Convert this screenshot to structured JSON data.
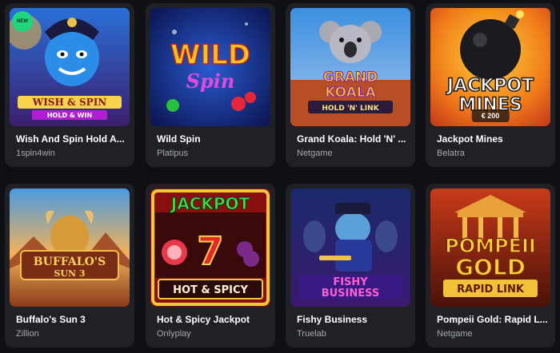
{
  "games": [
    {
      "title": "Wish And Spin Hold A...",
      "provider": "1spin4win",
      "badge": "NEW",
      "art_lines": [
        "WISH & SPIN",
        "HOLD & WIN"
      ]
    },
    {
      "title": "Wild Spin",
      "provider": "Platipus",
      "art_lines": [
        "WILD",
        "Spin"
      ]
    },
    {
      "title": "Grand Koala: Hold 'N' ...",
      "provider": "Netgame",
      "art_lines": [
        "GRAND",
        "KOALA",
        "HOLD 'N' LINK"
      ]
    },
    {
      "title": "Jackpot Mines",
      "provider": "Belatra",
      "price": "€ 200",
      "art_lines": [
        "JACKPOT",
        "MINES"
      ]
    },
    {
      "title": "Buffalo's Sun 3",
      "provider": "Zillion",
      "art_lines": [
        "BUFFALO'S",
        "SUN 3"
      ]
    },
    {
      "title": "Hot & Spicy Jackpot",
      "provider": "Onlyplay",
      "art_lines": [
        "JACKPOT",
        "HOT & SPICY"
      ]
    },
    {
      "title": "Fishy Business",
      "provider": "Truelab",
      "art_lines": [
        "FISHY",
        "BUSINESS"
      ]
    },
    {
      "title": "Pompeii Gold: Rapid L...",
      "provider": "Netgame",
      "art_lines": [
        "POMPEII",
        "GOLD",
        "RAPID LINK"
      ]
    }
  ],
  "colors": {
    "card_bg": "#1f2126",
    "page_bg": "#0f1014",
    "new_badge": "#1fd67e",
    "provider_text": "#a7a9b0"
  }
}
